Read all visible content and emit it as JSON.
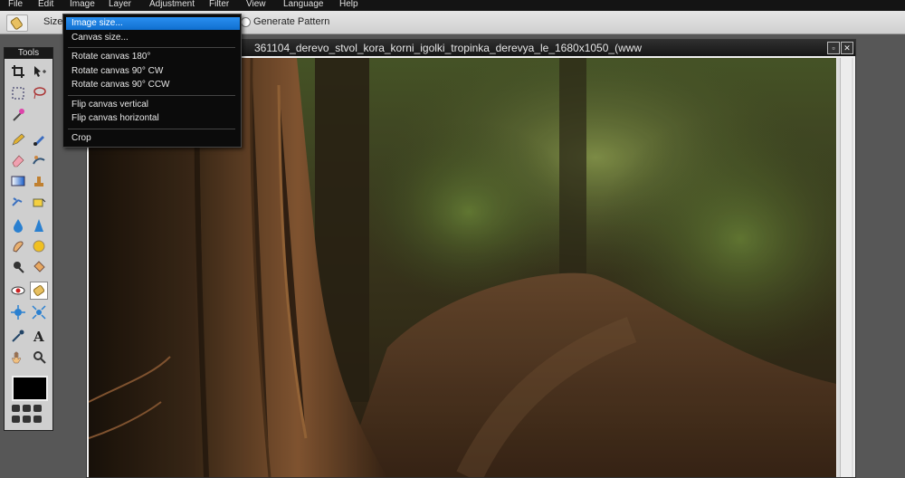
{
  "menubar": {
    "items": [
      "File",
      "Edit",
      "Image",
      "Layer",
      "Adjustment",
      "Filter",
      "View",
      "Language",
      "Help"
    ]
  },
  "options": {
    "size_label": "Size",
    "generate_pattern": "Generate Pattern"
  },
  "image_menu": {
    "items": [
      "Image size...",
      "Canvas size...",
      "Rotate canvas 180°",
      "Rotate canvas 90° CW",
      "Rotate canvas 90° CCW",
      "Flip canvas vertical",
      "Flip canvas horizontal",
      "Crop"
    ],
    "active_index": 0
  },
  "tools": {
    "title": "Tools",
    "foreground_color": "#000000"
  },
  "document": {
    "title": "361104_derevo_stvol_kora_korni_igolki_tropinka_derevya_le_1680x1050_(www"
  },
  "colors": {
    "menu_highlight": "#1f7fe0",
    "menubar_bg": "#141414",
    "workspace_bg": "#575757"
  }
}
